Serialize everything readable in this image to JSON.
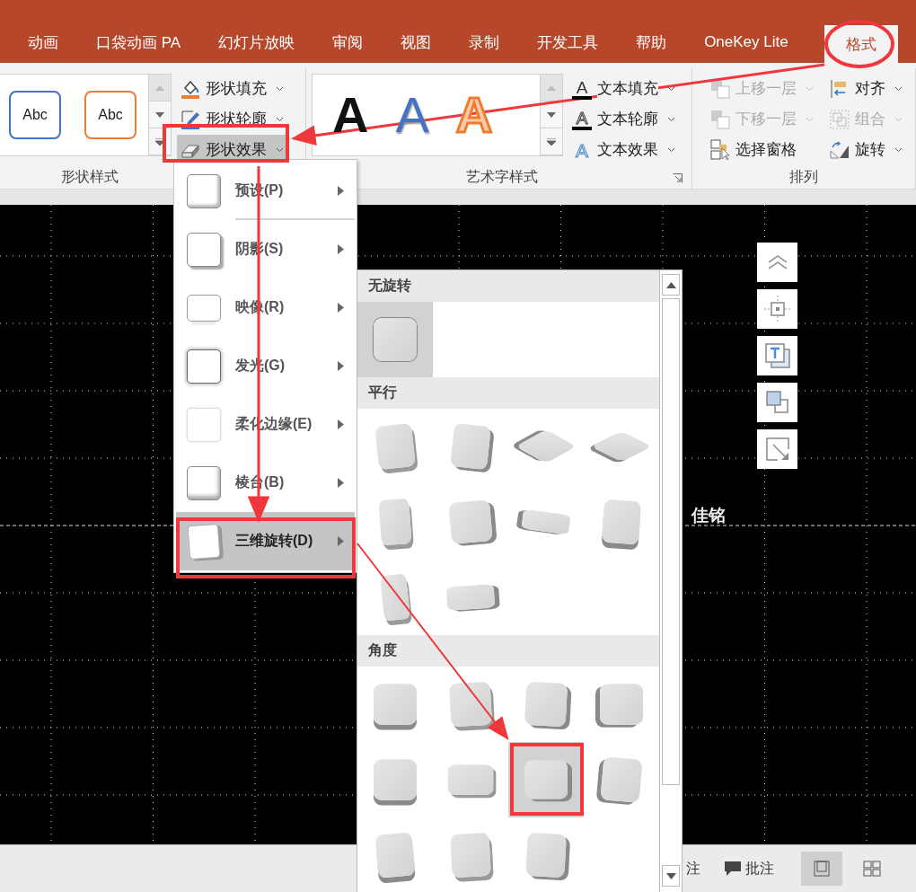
{
  "tabs": [
    {
      "label": "动画",
      "selected": false
    },
    {
      "label": "口袋动画 PA",
      "selected": false
    },
    {
      "label": "幻灯片放映",
      "selected": false
    },
    {
      "label": "审阅",
      "selected": false
    },
    {
      "label": "视图",
      "selected": false
    },
    {
      "label": "录制",
      "selected": false
    },
    {
      "label": "开发工具",
      "selected": false
    },
    {
      "label": "帮助",
      "selected": false
    },
    {
      "label": "OneKey Lite",
      "selected": false
    },
    {
      "label": "格式",
      "selected": true
    }
  ],
  "shape_styles": {
    "label": "形状样式",
    "gallery": [
      {
        "text": "Abc",
        "color": "#4472c4"
      },
      {
        "text": "Abc",
        "color": "#ed7d31"
      }
    ],
    "commands": [
      {
        "label": "形状填充",
        "kind": "fill",
        "selected": false
      },
      {
        "label": "形状轮廓",
        "kind": "outline",
        "selected": false
      },
      {
        "label": "形状效果",
        "kind": "effects",
        "selected": true
      }
    ]
  },
  "wordart_styles": {
    "label": "艺术字样式",
    "gallery": [
      {
        "text": "A",
        "kind": "black"
      },
      {
        "text": "A",
        "kind": "blue"
      },
      {
        "text": "A",
        "kind": "orange"
      }
    ],
    "commands": [
      {
        "label": "文本填充",
        "kind": "text-fill",
        "icon": "A"
      },
      {
        "label": "文本轮廓",
        "kind": "text-outline",
        "icon": "A"
      },
      {
        "label": "文本效果",
        "kind": "text-effects",
        "icon": "A"
      }
    ]
  },
  "arrange": {
    "label": "排列",
    "columns": [
      [
        {
          "label": "上移一层",
          "kind": "forward",
          "disabled": true,
          "dropdown": true
        },
        {
          "label": "下移一层",
          "kind": "backward",
          "disabled": true,
          "dropdown": true
        },
        {
          "label": "选择窗格",
          "kind": "pane",
          "disabled": false,
          "dropdown": false
        }
      ],
      [
        {
          "label": "对齐",
          "kind": "align",
          "disabled": false,
          "dropdown": true
        },
        {
          "label": "组合",
          "kind": "group",
          "disabled": true,
          "dropdown": true
        },
        {
          "label": "旋转",
          "kind": "rotate",
          "disabled": false,
          "dropdown": true
        }
      ]
    ]
  },
  "menu": {
    "items": [
      {
        "label": "预设(P)",
        "kind": "preset",
        "selected": false,
        "separator_after": true
      },
      {
        "label": "阴影(S)",
        "kind": "shadow",
        "selected": false,
        "separator_after": false
      },
      {
        "label": "映像(R)",
        "kind": "reflection",
        "selected": false,
        "separator_after": false
      },
      {
        "label": "发光(G)",
        "kind": "glow",
        "selected": false,
        "separator_after": false
      },
      {
        "label": "柔化边缘(E)",
        "kind": "soft-edges",
        "selected": false,
        "separator_after": false
      },
      {
        "label": "棱台(B)",
        "kind": "bevel",
        "selected": false,
        "separator_after": false
      },
      {
        "label": "三维旋转(D)",
        "kind": "rotation",
        "selected": true,
        "separator_after": false
      }
    ]
  },
  "submenu": {
    "sections": [
      {
        "title": "无旋转",
        "options": [
          {
            "selected": true
          }
        ]
      },
      {
        "title": "平行",
        "options": [
          {
            "selected": false
          },
          {
            "selected": false
          },
          {
            "selected": false
          },
          {
            "selected": false
          },
          {
            "selected": false
          },
          {
            "selected": false
          },
          {
            "selected": false
          },
          {
            "selected": false
          },
          {
            "selected": false
          },
          {
            "selected": false
          }
        ]
      },
      {
        "title": "角度",
        "options": [
          {
            "selected": false
          },
          {
            "selected": false
          },
          {
            "selected": false
          },
          {
            "selected": false
          },
          {
            "selected": false
          },
          {
            "selected": false
          },
          {
            "selected": true
          },
          {
            "selected": false
          },
          {
            "selected": false
          },
          {
            "selected": false
          },
          {
            "selected": false
          }
        ]
      }
    ]
  },
  "slide": {
    "text": "佳铭"
  },
  "status_bar": {
    "notes": "注",
    "comments": "批注"
  }
}
